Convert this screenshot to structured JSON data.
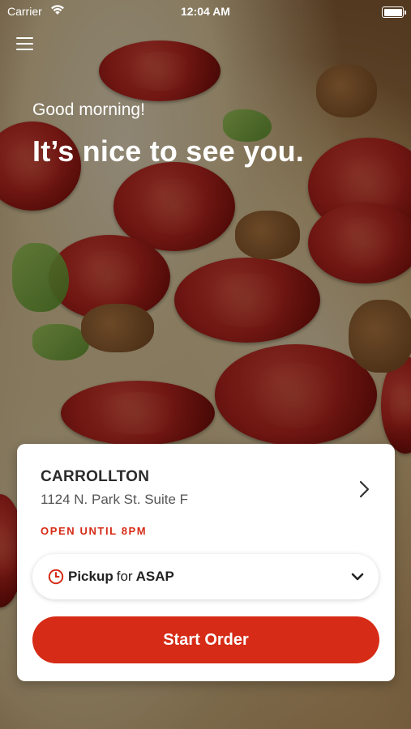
{
  "status_bar": {
    "carrier": "Carrier",
    "time": "12:04 AM"
  },
  "header": {
    "menu_icon": "hamburger-menu-icon"
  },
  "hero": {
    "greeting": "Good morning!",
    "headline": "It’s nice to see you."
  },
  "location_card": {
    "name": "CARROLLTON",
    "address": "1124 N. Park St. Suite F",
    "hours_status": "OPEN UNTIL 8PM",
    "hours_color": "#d62b16",
    "chevron_icon": "chevron-right-icon"
  },
  "order_mode": {
    "mode": "Pickup",
    "connector": "for",
    "time": "ASAP",
    "clock_icon": "clock-icon",
    "dropdown_icon": "chevron-down-icon"
  },
  "cta": {
    "label": "Start Order",
    "color": "#d62b16"
  }
}
